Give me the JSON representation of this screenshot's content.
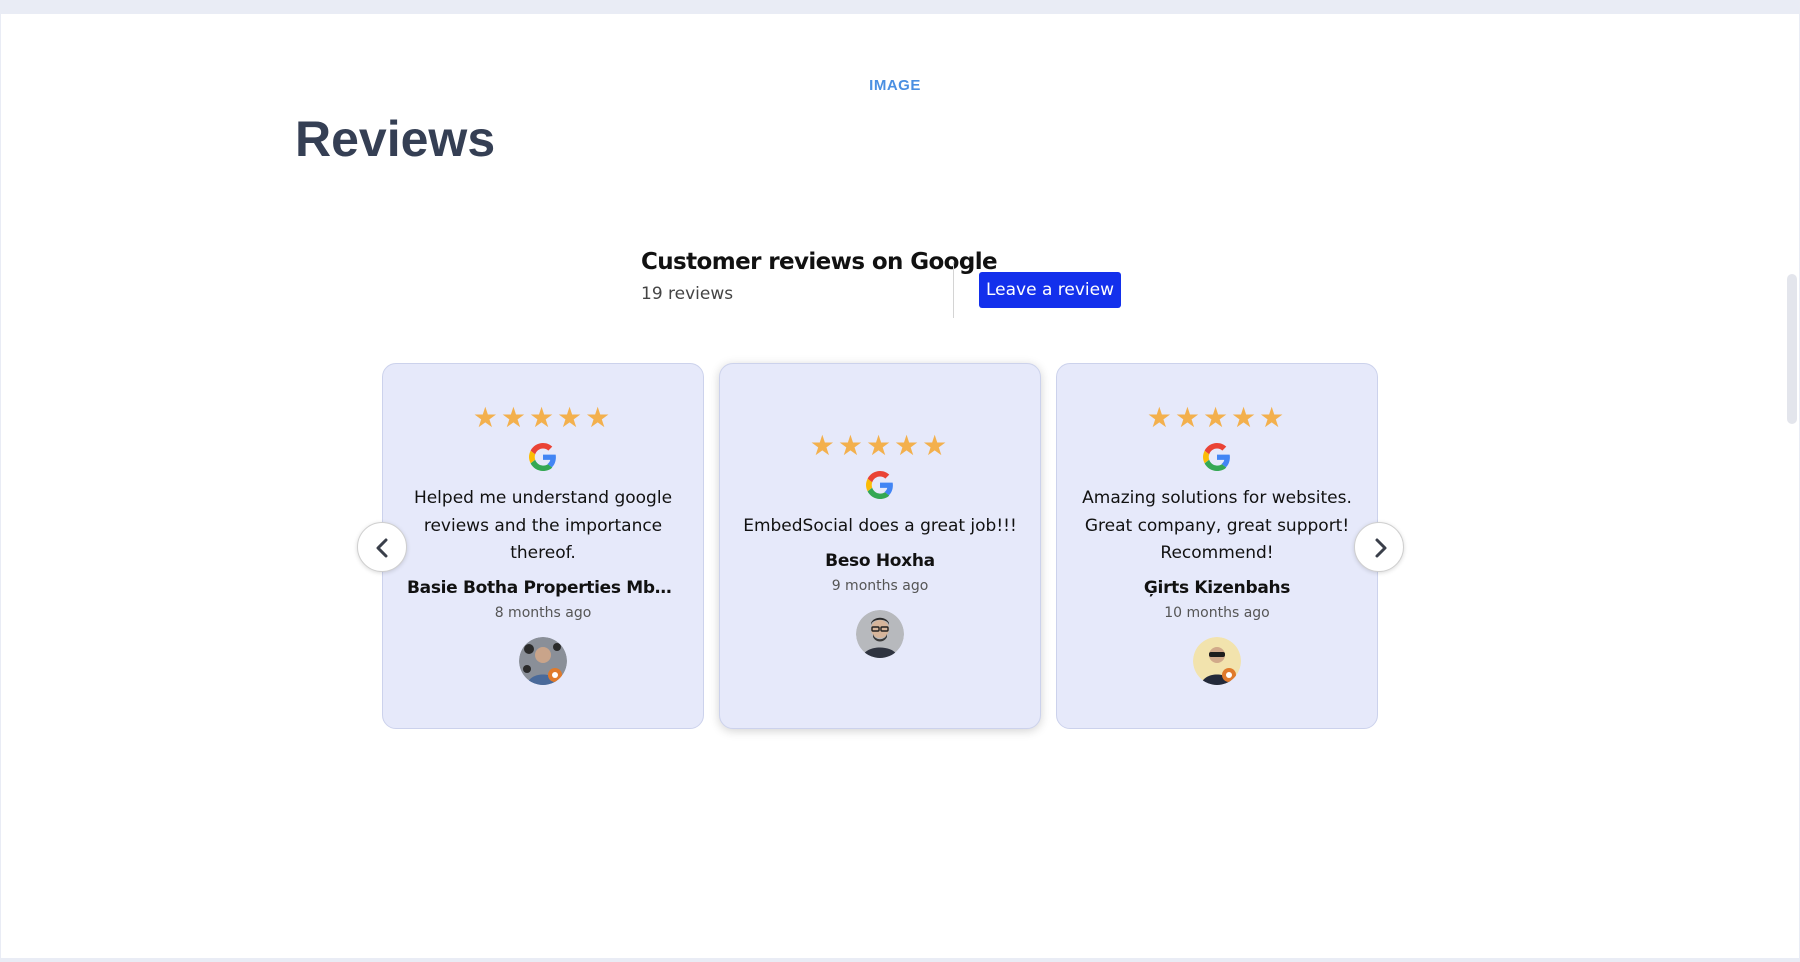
{
  "section": {
    "label": "IMAGE",
    "title": "Reviews"
  },
  "widget": {
    "title": "Customer reviews on Google",
    "count": "19 reviews",
    "button_label": "Leave a review"
  },
  "reviews": [
    {
      "stars": "★★★★★",
      "rating": 5,
      "text": "Helped me understand google reviews and the importance thereof.",
      "name": "Basie Botha Properties Mbombel…",
      "date": "8 months ago",
      "avatar": "person-avatar"
    },
    {
      "stars": "★★★★★",
      "rating": 5,
      "text": "EmbedSocial does a great job!!!",
      "name": "Beso Hoxha",
      "date": "9 months ago",
      "avatar": "person-avatar"
    },
    {
      "stars": "★★★★★",
      "rating": 5,
      "text": "Amazing solutions for websites. Great company, great support! Recommend!",
      "name": "Ģirts Kizenbahs",
      "date": "10 months ago",
      "avatar": "person-avatar"
    }
  ],
  "icons": {
    "prev": "chevron-left-icon",
    "next": "chevron-right-icon",
    "source": "google-icon"
  },
  "colors": {
    "title": "#353f54",
    "accent_label": "#4a8fe2",
    "button": "#1330ec",
    "star": "#f3b04d",
    "card": "#e6e9fa"
  }
}
